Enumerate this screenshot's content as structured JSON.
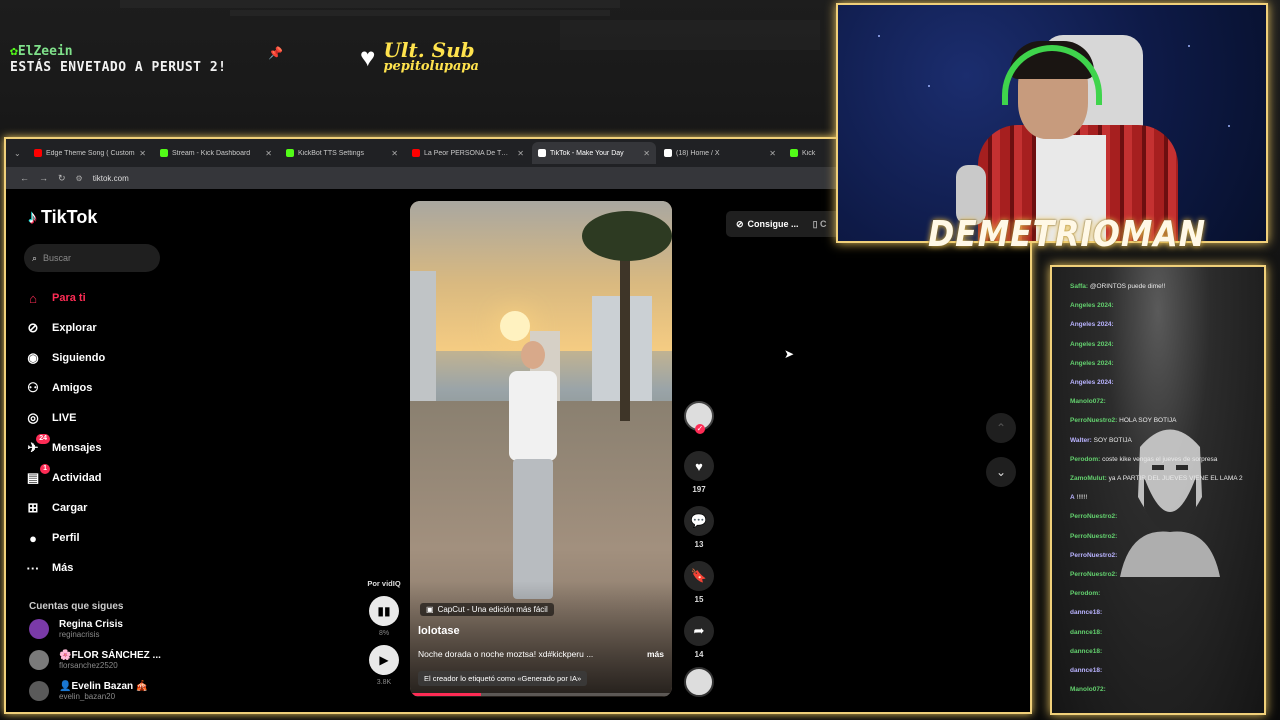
{
  "overlay": {
    "alert_user": "ElZeein",
    "alert_message": "ESTÁS ENVETADO A PERUST 2!",
    "ult_sub_label": "Ult. Sub",
    "ult_sub_name": "pepitolupapa",
    "streamer_name": "DEMETRIOMAN"
  },
  "browser": {
    "tabs": [
      {
        "title": "Edge Theme Song ( Custom",
        "color": "#ff0000",
        "active": false
      },
      {
        "title": "Stream - Kick Dashboard",
        "color": "#53fc18",
        "active": false
      },
      {
        "title": "KickBot TTS Settings",
        "color": "#53fc18",
        "active": false
      },
      {
        "title": "La Peor PERSONA De TODO KI",
        "color": "#ff0000",
        "active": false
      },
      {
        "title": "TikTok - Make Your Day",
        "color": "#ffffff",
        "active": true
      },
      {
        "title": "(18) Home / X",
        "color": "#ffffff",
        "active": false
      },
      {
        "title": "Kick",
        "color": "#53fc18",
        "active": false
      }
    ],
    "url": "tiktok.com"
  },
  "tiktok": {
    "brand": "TikTok",
    "search_placeholder": "Buscar",
    "nav": [
      {
        "label": "Para ti",
        "icon": "home-icon",
        "badge": ""
      },
      {
        "label": "Explorar",
        "icon": "compass-icon",
        "badge": ""
      },
      {
        "label": "Siguiendo",
        "icon": "following-avatar-icon",
        "badge": ""
      },
      {
        "label": "Amigos",
        "icon": "friends-icon",
        "badge": ""
      },
      {
        "label": "LIVE",
        "icon": "live-icon",
        "badge": ""
      },
      {
        "label": "Mensajes",
        "icon": "messages-icon",
        "badge": "24"
      },
      {
        "label": "Actividad",
        "icon": "activity-icon",
        "badge": "1"
      },
      {
        "label": "Cargar",
        "icon": "upload-icon",
        "badge": ""
      },
      {
        "label": "Perfil",
        "icon": "profile-icon",
        "badge": ""
      },
      {
        "label": "Más",
        "icon": "more-icon",
        "badge": ""
      }
    ],
    "following_title": "Cuentas que sigues",
    "following": [
      {
        "name": "Regina Crisis",
        "handle": "reginacrisis",
        "color": "#7a3aa8"
      },
      {
        "name": "🌸FLOR SÁNCHEZ ...",
        "handle": "florsanchez2520",
        "color": "#7a7a7a"
      },
      {
        "name": "👤Evelin Bazan 🎪",
        "handle": "evelin_bazan20",
        "color": "#5a5a5a"
      }
    ],
    "get_app": "Consigue ...",
    "video": {
      "capcut": "CapCut - Una edición más fácil",
      "username": "lolotase",
      "description": "Noche dorada o noche moztsa! xd#kickperu ...",
      "more": "más",
      "ai_label": "El creador lo etiquetó como «Generado por IA»",
      "progress": 0.27
    },
    "actions": {
      "likes": "197",
      "comments": "13",
      "saves": "15",
      "shares": "14"
    },
    "vidiq": {
      "label": "Por vidIQ",
      "percent": "8%",
      "views": "3.8K"
    }
  },
  "chat": {
    "lines": [
      {
        "user": "Saffa:",
        "text": "@ORINTOS puede dime!!"
      },
      {
        "user": "Angeles 2024:",
        "text": ""
      },
      {
        "user": "Angeles 2024:",
        "text": ""
      },
      {
        "user": "Angeles 2024:",
        "text": ""
      },
      {
        "user": "Angeles 2024:",
        "text": ""
      },
      {
        "user": "Angeles 2024:",
        "text": ""
      },
      {
        "user": "Manolo072:",
        "text": ""
      },
      {
        "user": "PerroNuestro2:",
        "text": "HOLA SOY BOTIJA"
      },
      {
        "user": "Walter:",
        "text": "SOY BOTIJA"
      },
      {
        "user": "Perodom:",
        "text": "coste kike vengas el jueves de sorpresa"
      },
      {
        "user": "ZamoMulut:",
        "text": "ya A PARTIR DEL JUEVES VIENE EL LAMA 2"
      },
      {
        "user": "A",
        "text": "!!!!!!"
      },
      {
        "user": "PerroNuestro2:",
        "text": ""
      },
      {
        "user": "PerroNuestro2:",
        "text": ""
      },
      {
        "user": "PerroNuestro2:",
        "text": ""
      },
      {
        "user": "PerroNuestro2:",
        "text": ""
      },
      {
        "user": "Perodom:",
        "text": ""
      },
      {
        "user": "dannce18:",
        "text": ""
      },
      {
        "user": "dannce18:",
        "text": ""
      },
      {
        "user": "dannce18:",
        "text": ""
      },
      {
        "user": "dannce18:",
        "text": ""
      },
      {
        "user": "Manolo072:",
        "text": ""
      }
    ]
  },
  "colors": {
    "accent_gold": "#f0d07a",
    "tiktok_red": "#fe2c55",
    "tiktok_cyan": "#25f4ee",
    "alert_green": "#7fe08a",
    "ult_sub_yellow": "#ffe34d"
  }
}
